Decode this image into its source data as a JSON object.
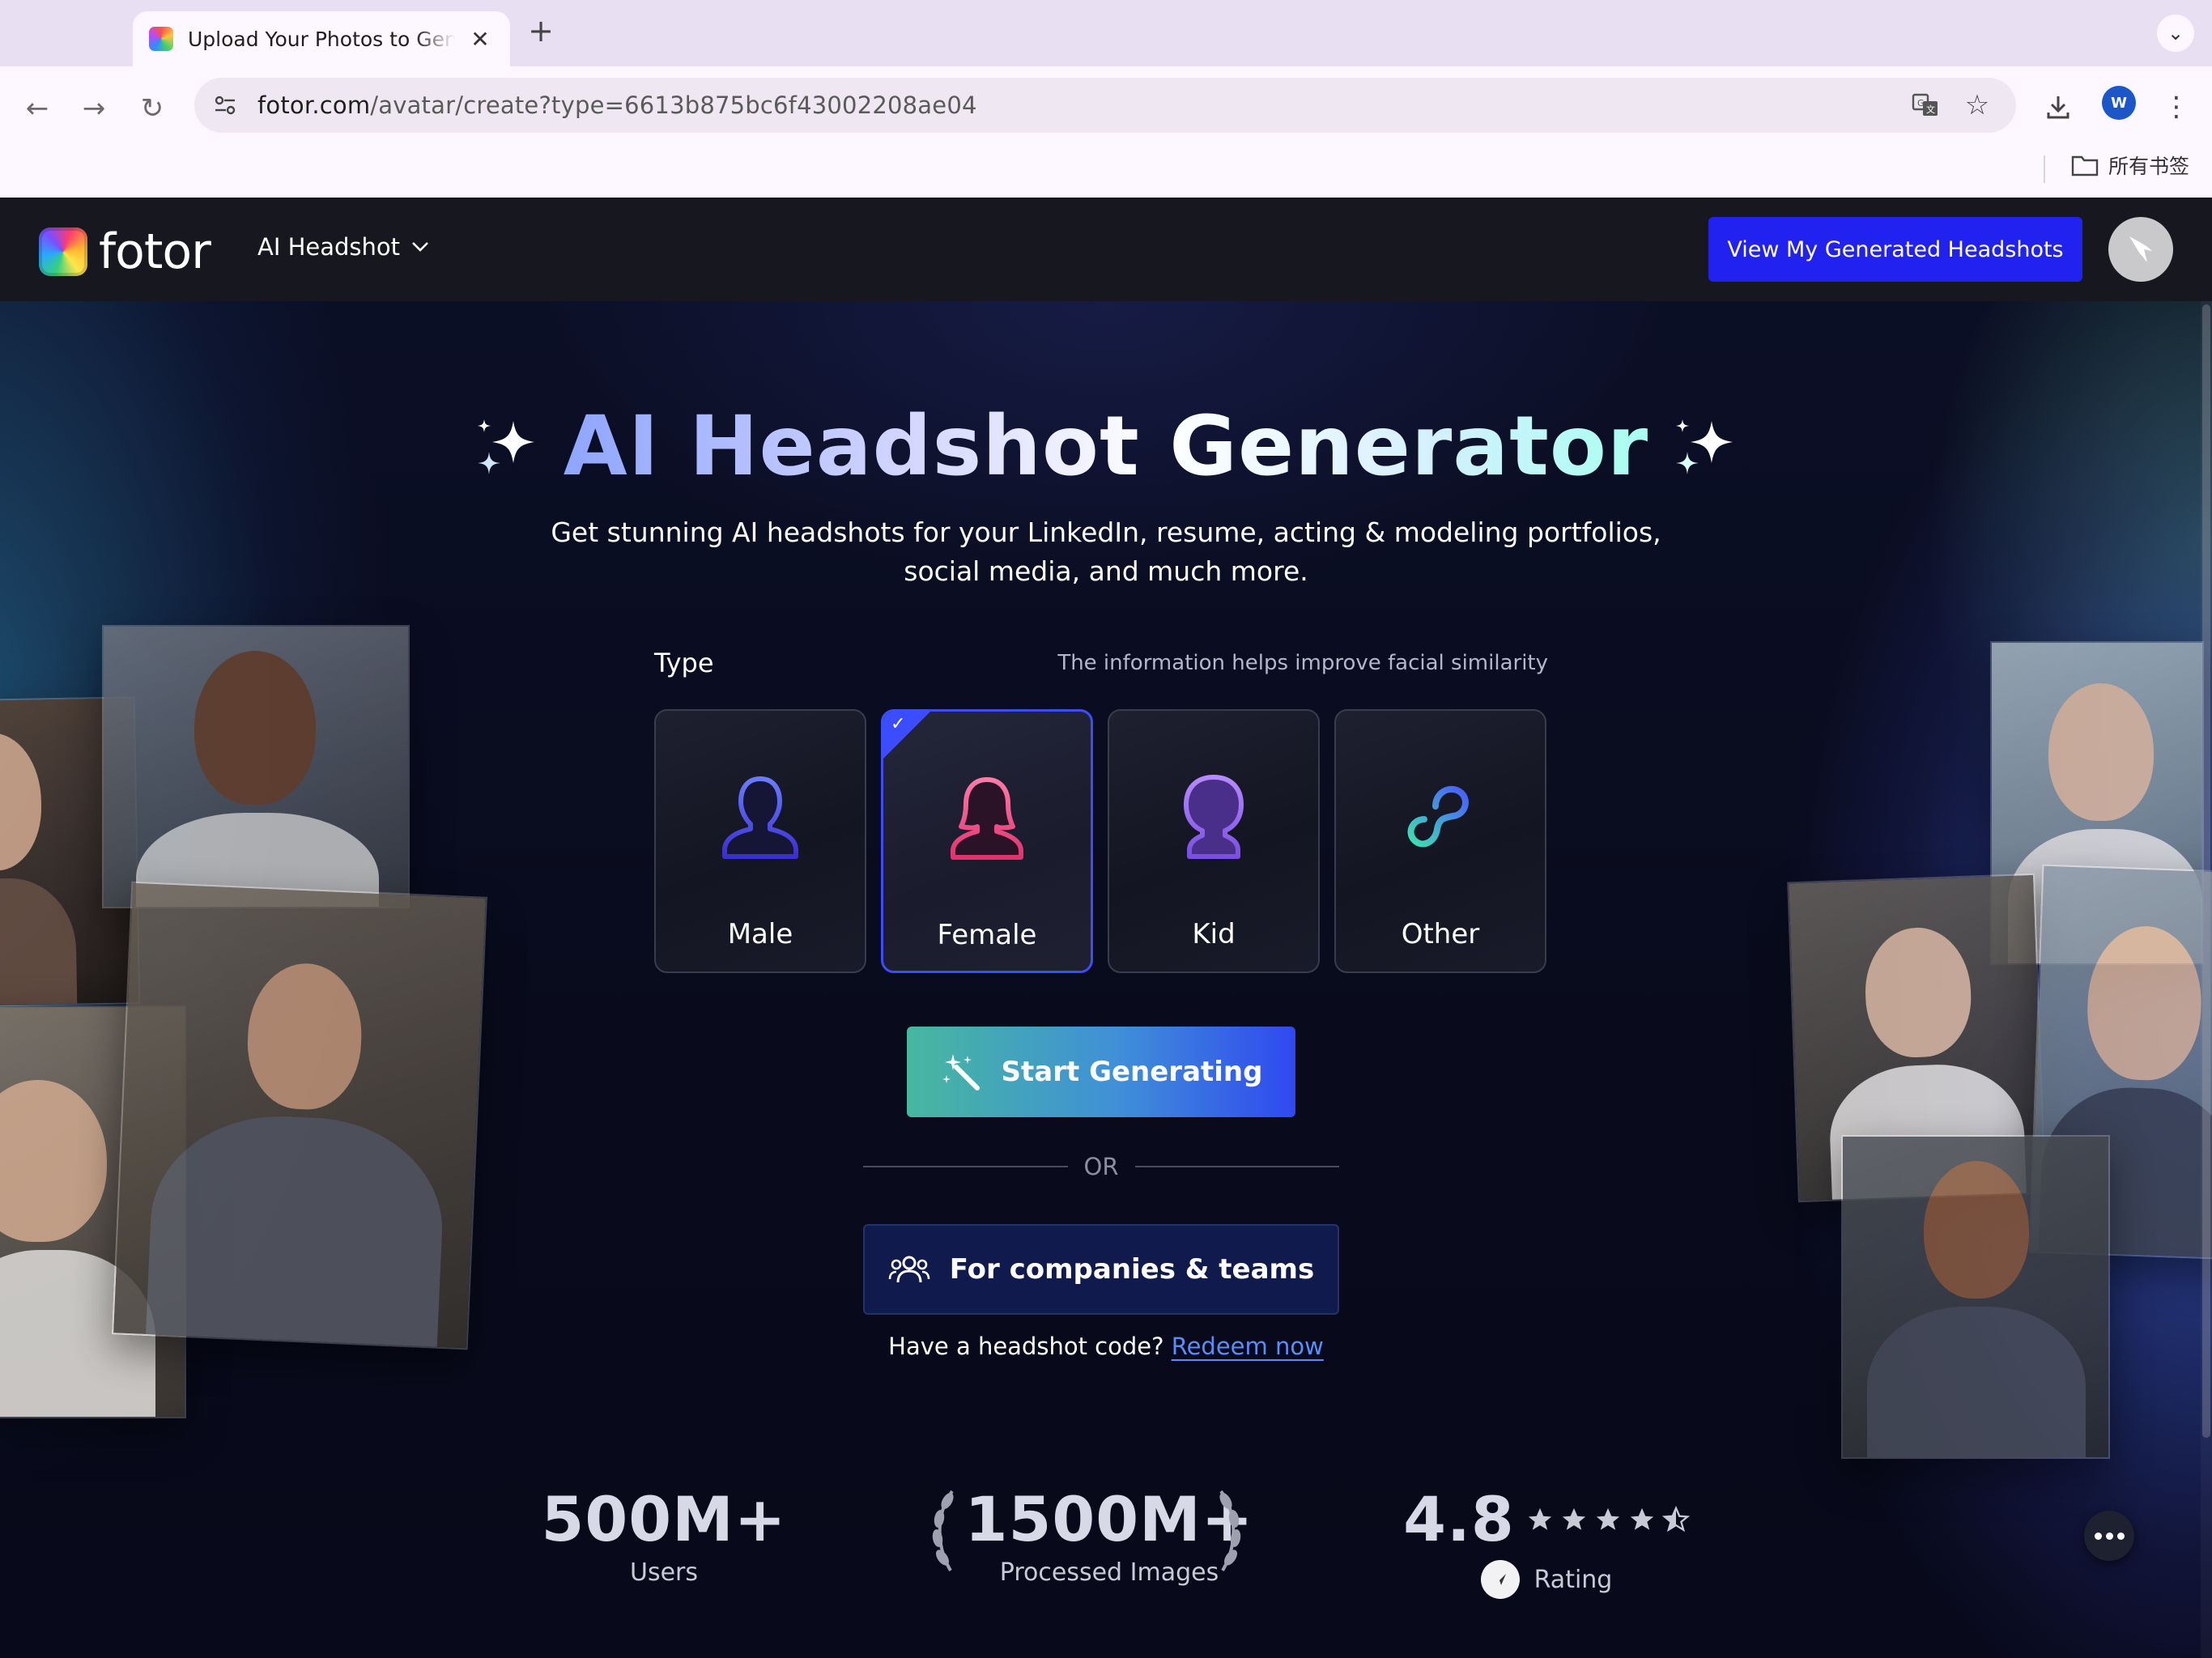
{
  "browser": {
    "tab_title": "Upload Your Photos to Generate AI Headshots",
    "url_domain": "fotor.com",
    "url_path": "/avatar/create?type=6613b875bc6f43002208ae04",
    "profile_initial": "W",
    "bookmarks_label": "所有书签"
  },
  "header": {
    "logo_text": "fotor",
    "product_menu": "AI Headshot",
    "view_button": "View My Generated Headshots"
  },
  "hero": {
    "title": "AI Headshot Generator",
    "subtitle": "Get stunning AI headshots for your LinkedIn, resume, acting & modeling portfolios, social media, and much more."
  },
  "type_section": {
    "label": "Type",
    "hint": "The information helps improve facial similarity",
    "options": [
      {
        "label": "Male",
        "selected": false
      },
      {
        "label": "Female",
        "selected": true
      },
      {
        "label": "Kid",
        "selected": false
      },
      {
        "label": "Other",
        "selected": false
      }
    ]
  },
  "actions": {
    "start_label": "Start Generating",
    "or_label": "OR",
    "teams_label": "For companies & teams",
    "redeem_prefix": "Have a headshot code?",
    "redeem_link": "Redeem now"
  },
  "stats": {
    "users_num": "500M+",
    "users_label": "Users",
    "images_num": "1500M+",
    "images_label": "Processed Images",
    "rating_num": "4.8",
    "rating_label": "Rating",
    "rating_stars": 4.5
  },
  "colors": {
    "accent": "#2222f0",
    "selected_border": "#3b4dff",
    "link": "#5b8cff"
  }
}
